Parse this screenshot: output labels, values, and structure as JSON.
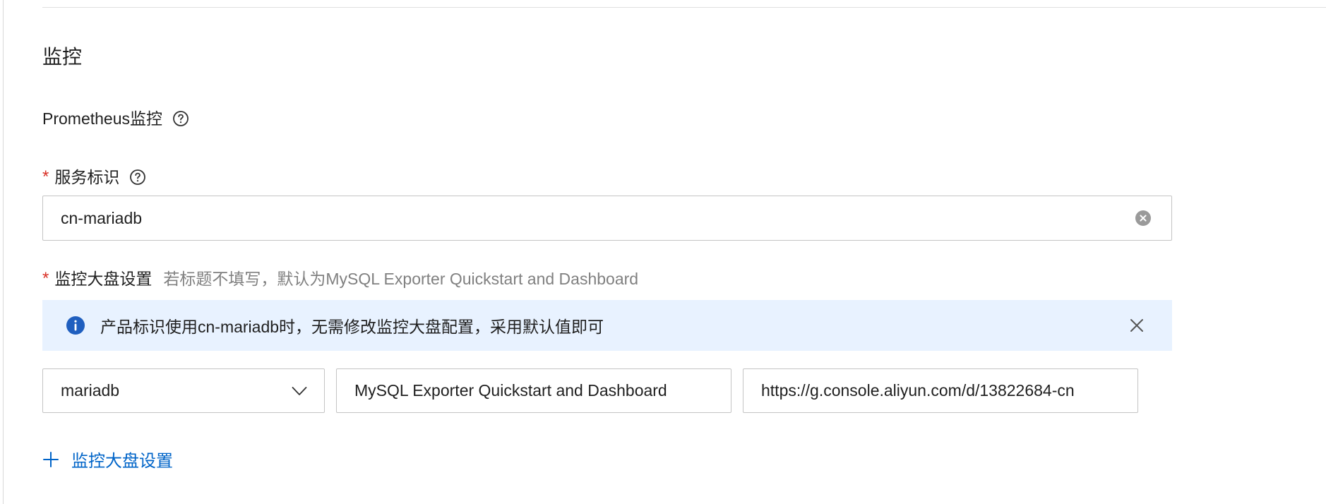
{
  "section": {
    "title": "监控"
  },
  "prometheus": {
    "label": "Prometheus监控",
    "help_icon": "help-circle-icon"
  },
  "service_id": {
    "required_mark": "*",
    "label": "服务标识",
    "help_icon": "help-circle-icon",
    "value": "cn-mariadb",
    "clear_icon": "clear-circle-icon"
  },
  "dashboard": {
    "required_mark": "*",
    "label": "监控大盘设置",
    "hint": "若标题不填写，默认为MySQL Exporter Quickstart and Dashboard",
    "alert": {
      "icon": "info-icon",
      "text": "产品标识使用cn-mariadb时，无需修改监控大盘配置，采用默认值即可",
      "close_icon": "close-icon"
    },
    "rows": [
      {
        "type_value": "mariadb",
        "title_value": "MySQL Exporter Quickstart and Dashboard",
        "url_value": "https://g.console.aliyun.com/d/13822684-cn"
      }
    ],
    "add_label": "监控大盘设置",
    "add_icon": "plus-icon"
  },
  "colors": {
    "required": "#d93026",
    "link": "#0064c8",
    "alert_background": "#e8f2ff",
    "info_icon": "#1f5fbf",
    "border": "#c4c4c4",
    "hint": "#808080"
  }
}
